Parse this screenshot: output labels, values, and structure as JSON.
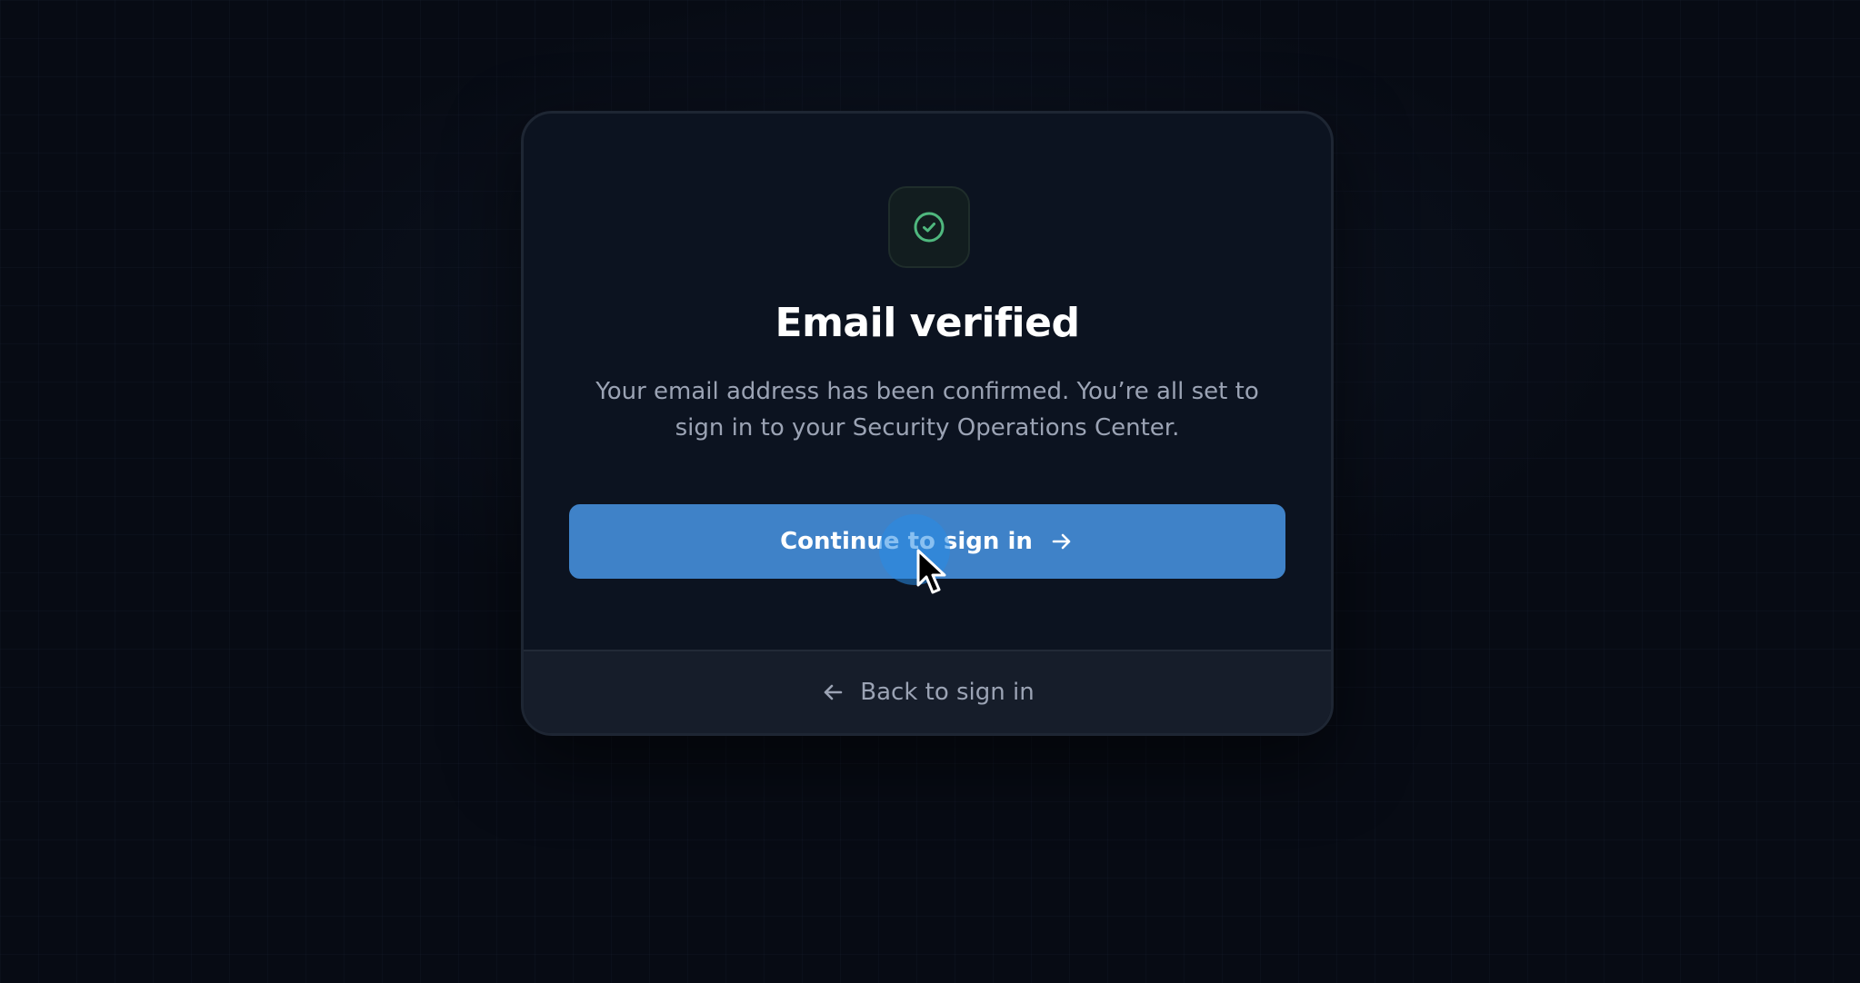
{
  "card": {
    "status_icon": "check-circle-icon",
    "title": "Email verified",
    "description": "Your email address has been confirmed. You’re all set to sign in to your Security Operations Center.",
    "primary_button": {
      "label": "Continue to sign in",
      "icon": "arrow-right-icon"
    },
    "footer_link": {
      "label": "Back to sign in",
      "icon": "arrow-left-icon"
    }
  },
  "colors": {
    "background": "#070b14",
    "card": "#0c1320",
    "accent": "#3f82c8",
    "success": "#4fb87e",
    "muted_text": "#9ba3b4"
  }
}
